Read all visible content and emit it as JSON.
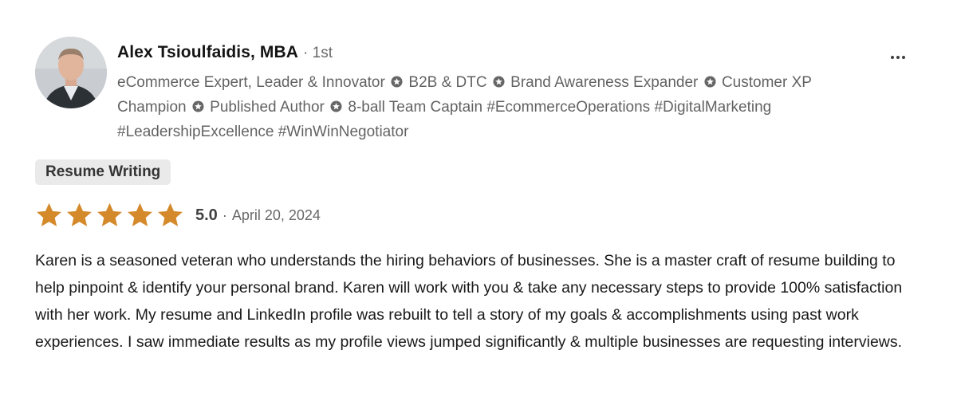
{
  "reviewer": {
    "name": "Alex Tsioulfaidis, MBA",
    "connection_degree": "· 1st",
    "headline_parts": [
      "eCommerce Expert, Leader & Innovator",
      "B2B & DTC",
      "Brand Awareness Expander",
      "Customer XP Champion",
      "Published Author",
      "8-ball Team Captain #EcommerceOperations #DigitalMarketing #LeadershipExcellence #WinWinNegotiator"
    ],
    "separator_icon": "star-circle-icon"
  },
  "actions": {
    "more_icon": "ellipsis-icon"
  },
  "service_tag": "Resume Writing",
  "rating": {
    "stars": 5,
    "max_stars": 5,
    "star_color": "#d4892a",
    "value": "5.0",
    "separator": "·",
    "date": "April 20, 2024"
  },
  "review": {
    "text": "Karen is a seasoned veteran who understands the hiring behaviors of businesses. She is a master craft of resume building to help pinpoint & identify your personal brand. Karen will work with you & take any necessary steps to provide 100% satisfaction with her work. My resume and LinkedIn profile was rebuilt to tell a story of my goals & accomplishments using past work experiences. I saw immediate results as my profile views jumped significantly & multiple businesses are requesting interviews."
  }
}
